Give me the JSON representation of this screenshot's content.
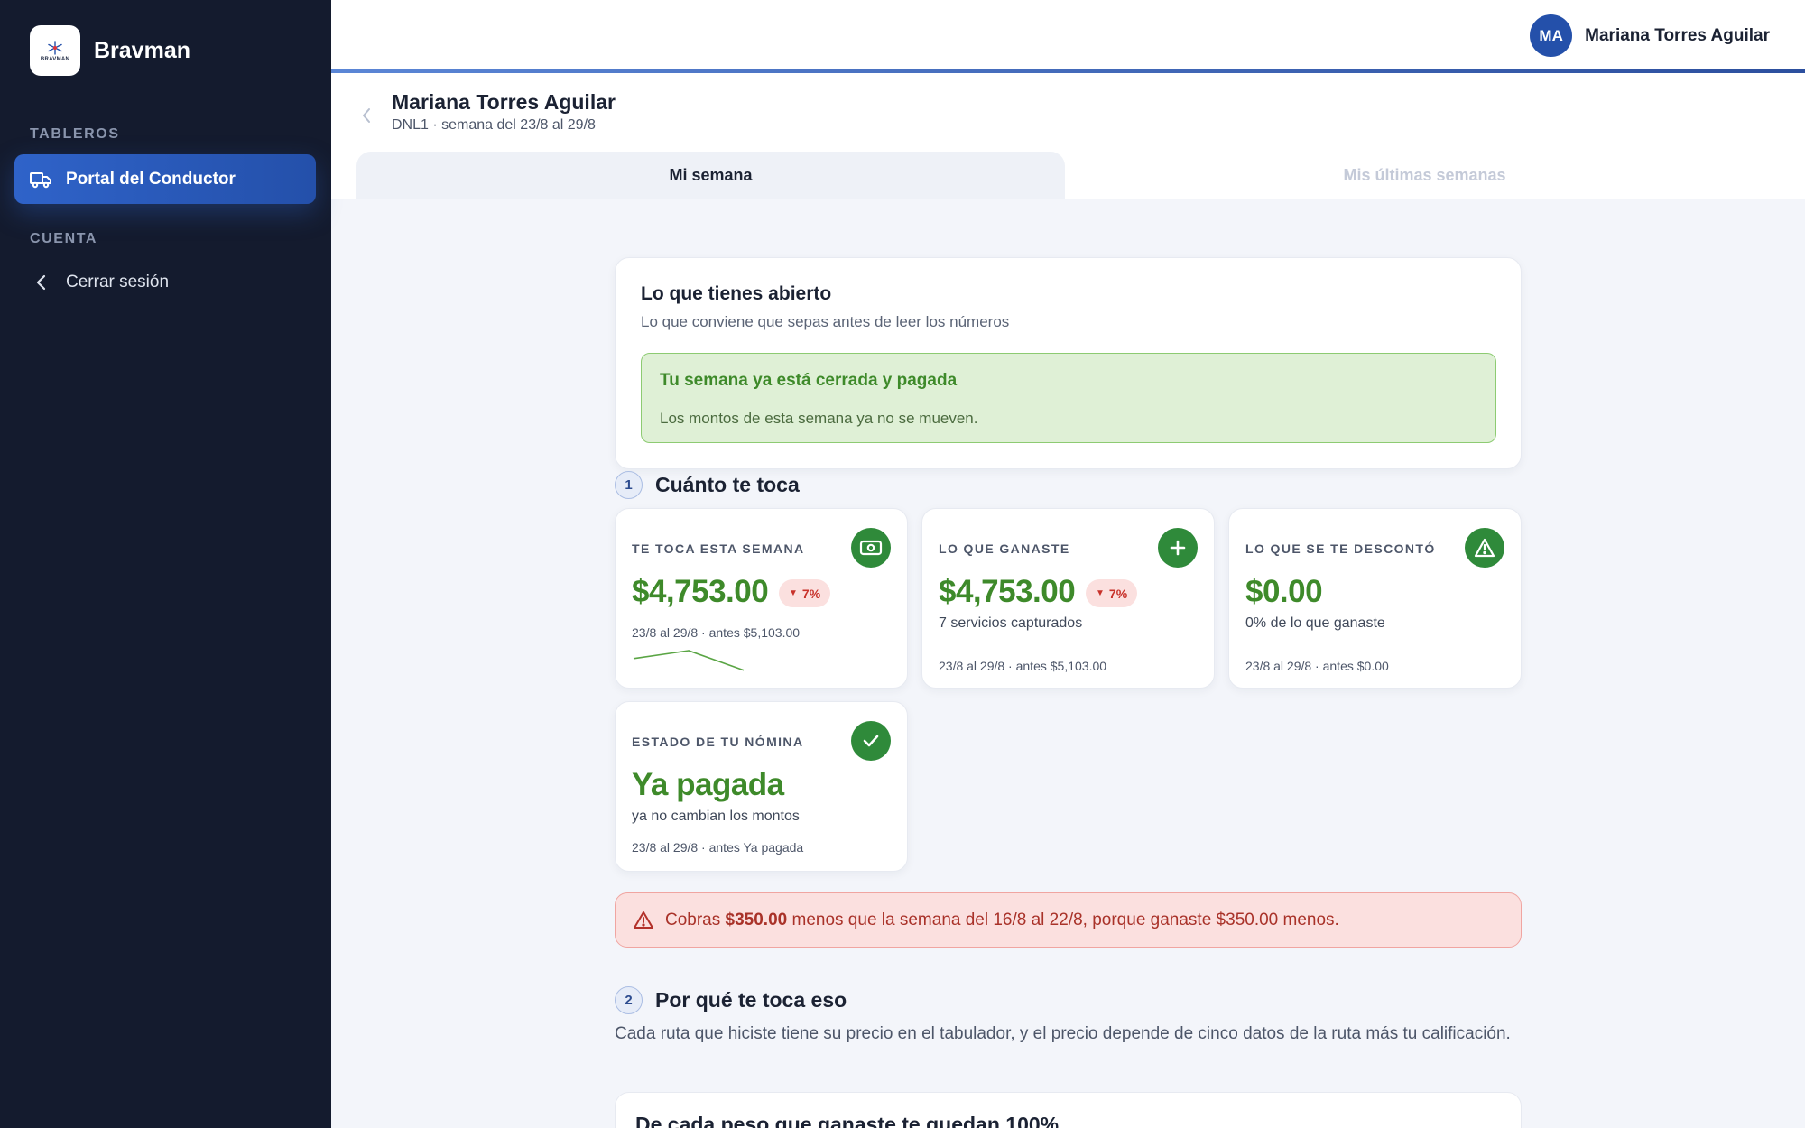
{
  "app": {
    "name": "Bravman",
    "logo_text": "BRAVMAN"
  },
  "sidebar": {
    "section_dashboards": "TABLEROS",
    "section_account": "CUENTA",
    "items": [
      {
        "label": "Portal del Conductor",
        "icon": "truck-icon",
        "active": true
      },
      {
        "label": "Cerrar sesión",
        "icon": "chevron-left-icon",
        "active": false
      }
    ]
  },
  "user": {
    "initials": "MA",
    "name": "Mariana Torres Aguilar"
  },
  "header": {
    "title": "Mariana Torres Aguilar",
    "subtitle": "DNL1 · semana del 23/8 al 29/8",
    "tabs": [
      {
        "label": "Mi semana",
        "active": true
      },
      {
        "label": "Mis últimas semanas",
        "active": false
      }
    ]
  },
  "open_items": {
    "title": "Lo que tienes abierto",
    "subtitle": "Lo que conviene que sepas antes de leer los números",
    "notice_title": "Tu semana ya está cerrada y pagada",
    "notice_text": "Los montos de esta semana ya no se mueven."
  },
  "section1": {
    "number": "1",
    "title": "Cuánto te toca"
  },
  "metrics": [
    {
      "label": "TE TOCA ESTA SEMANA",
      "icon": "money-icon",
      "value": "$4,753.00",
      "change": "7%",
      "change_dir": "down",
      "footer": "23/8 al 29/8 · antes $5,103.00",
      "sparkline": [
        5103,
        5340,
        4753
      ]
    },
    {
      "label": "LO QUE GANASTE",
      "icon": "plus-icon",
      "value": "$4,753.00",
      "change": "7%",
      "change_dir": "down",
      "sub": "7 servicios capturados",
      "footer": "23/8 al 29/8 · antes $5,103.00"
    },
    {
      "label": "LO QUE SE TE DESCONTÓ",
      "icon": "warning-icon",
      "value": "$0.00",
      "sub": "0% de lo que ganaste",
      "footer": "23/8 al 29/8 · antes $0.00"
    },
    {
      "label": "ESTADO DE TU NÓMINA",
      "icon": "check-icon",
      "value": "Ya pagada",
      "sub": "ya no cambian los montos",
      "footer": "23/8 al 29/8 · antes Ya pagada"
    }
  ],
  "alert": {
    "prefix": "Cobras",
    "amount": "$350.00",
    "suffix": "menos que la semana del 16/8 al 22/8, porque ganaste $350.00 menos."
  },
  "section2": {
    "number": "2",
    "title": "Por qué te toca eso",
    "description": "Cada ruta que hiciste tiene su precio en el tabulador, y el precio depende de cinco datos de la ruta más tu calificación.",
    "card_title": "De cada peso que ganaste te quedan 100%"
  },
  "colors": {
    "sidebar_bg": "#141b2e",
    "accent": "#2f63c9",
    "success": "#3e8a2a",
    "danger": "#c8312a"
  }
}
